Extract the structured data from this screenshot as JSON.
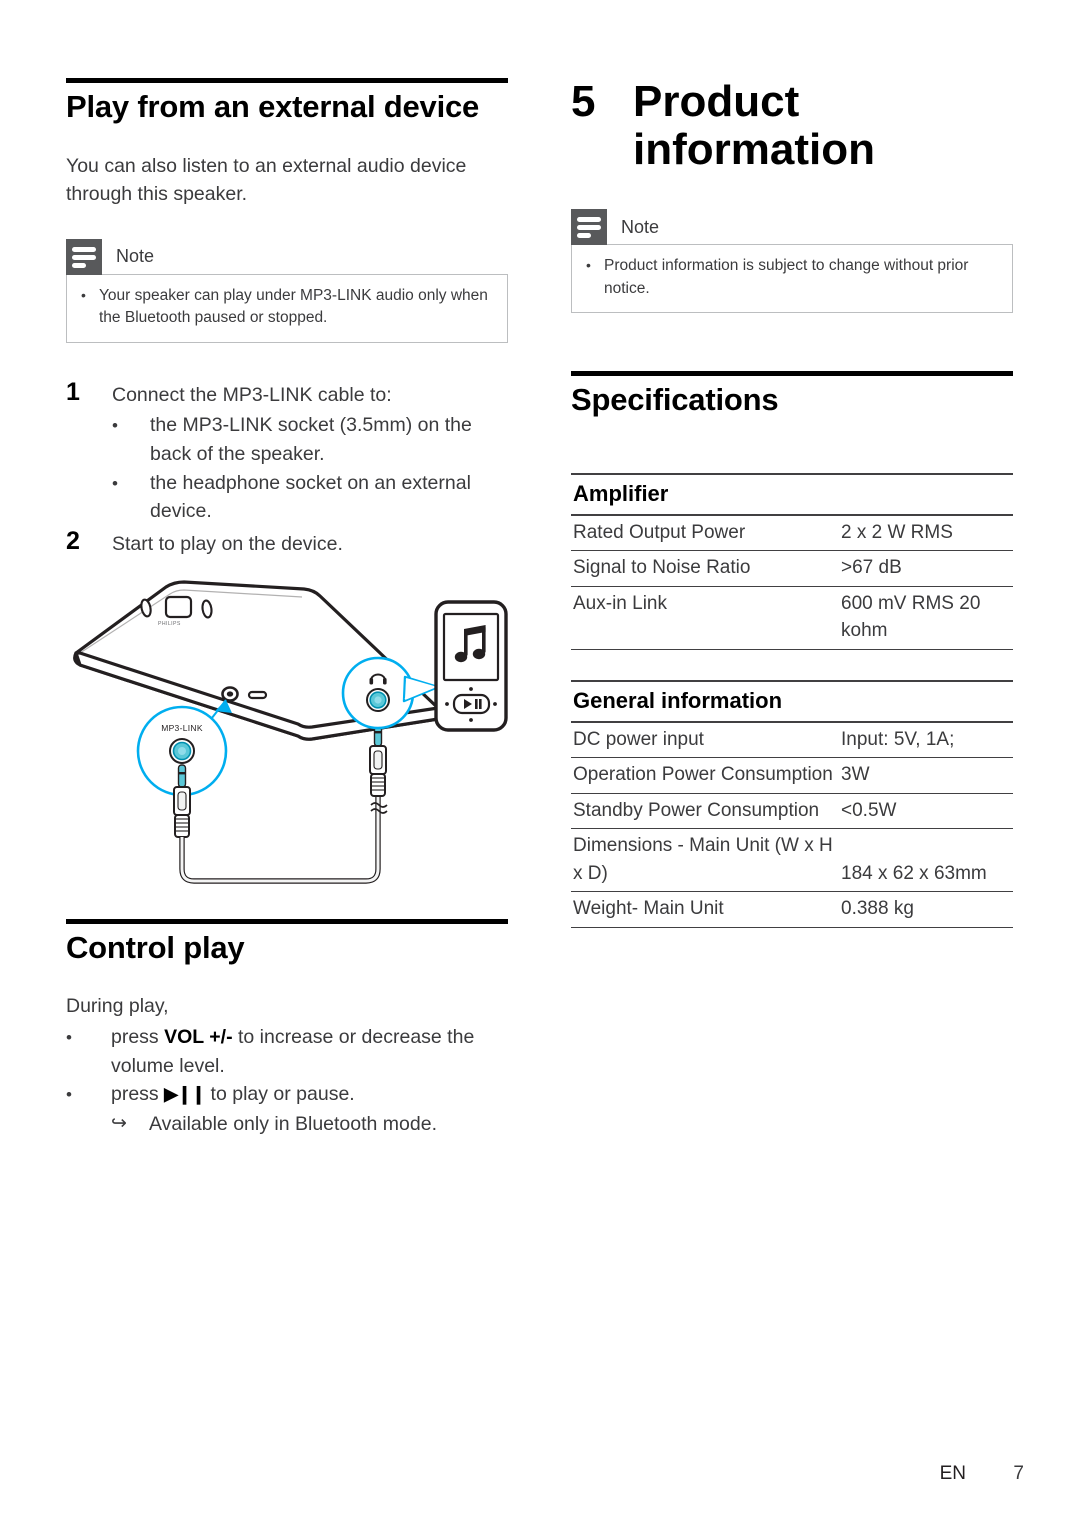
{
  "left_column": {
    "heading": "Play from an external device",
    "intro": "You can also listen to an external audio device through this speaker.",
    "note": {
      "label": "Note",
      "bullet": "Your speaker can play under MP3-LINK audio only when the Bluetooth paused or stopped."
    },
    "steps": [
      {
        "num": "1",
        "text": "Connect the MP3-LINK cable to:"
      },
      {
        "num": "2",
        "text": "Start to play on the device."
      }
    ],
    "substeps": [
      "the MP3-LINK socket (3.5mm) on the back of the speaker.",
      "the headphone socket on an external device."
    ],
    "figure": {
      "socket_label": "MP3-LINK",
      "speaker_brand": "PHILIPS",
      "player_screen_icon": "music-note-icon",
      "player_button_icon": "play-pause-icon",
      "callout_icon": "headphone-icon"
    },
    "control_play": {
      "heading": "Control play",
      "intro": "During play,",
      "bullets": [
        {
          "pre": "press ",
          "bold": "VOL +/-",
          "post": " to increase or decrease the volume level."
        },
        {
          "pre": "press ",
          "symbol": "▶❙❙",
          "post": " to play or pause."
        }
      ],
      "sub_arrow": "Available only in Bluetooth mode."
    }
  },
  "right_column": {
    "chapter_number": "5",
    "chapter_title": "Product information",
    "note": {
      "label": "Note",
      "bullet": "Product information is subject to change without prior notice."
    },
    "specifications_heading": "Specifications",
    "groups": [
      {
        "title": "Amplifier",
        "rows": [
          {
            "key": "Rated Output Power",
            "value": "2 x 2 W RMS"
          },
          {
            "key": "Signal to Noise Ratio",
            "value": ">67 dB"
          },
          {
            "key": "Aux-in Link",
            "value": "600 mV RMS 20 kohm"
          }
        ]
      },
      {
        "title": "General information",
        "rows": [
          {
            "key": "DC power input",
            "value": "Input: 5V, 1A;"
          },
          {
            "key": "Operation Power Consumption",
            "value": "3W"
          },
          {
            "key": "Standby Power Consumption",
            "value": "<0.5W"
          },
          {
            "key": "Dimensions - Main Unit (W x H x D)",
            "value": "184 x 62 x 63mm"
          },
          {
            "key": "Weight- Main Unit",
            "value": "0.388 kg"
          }
        ]
      }
    ]
  },
  "footer": {
    "language": "EN",
    "page": "7"
  },
  "colors": {
    "accent_blue": "#00AEEF",
    "socket_cyan": "#5BC8D8",
    "note_gray": "#58595B",
    "text": "#3B3B3D",
    "rule": "#414042"
  }
}
